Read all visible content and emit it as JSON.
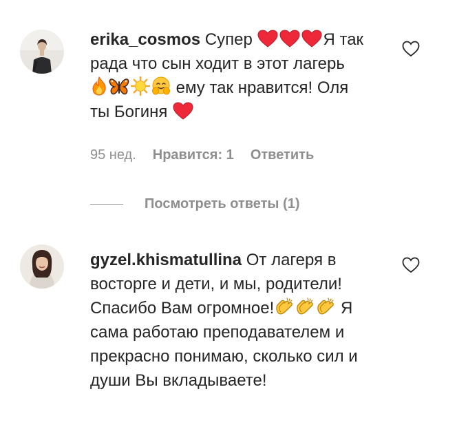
{
  "comments": [
    {
      "username": "erika_cosmos",
      "text_parts": [
        " Супер ",
        "Я так рада что сын ходит в этот лагерь ",
        " ему так нравится! Оля ты Богиня "
      ],
      "emojis": [
        "red-heart",
        "red-heart",
        "red-heart",
        "fire",
        "butterfly",
        "sun",
        "smiling-face-with-hands",
        "red-heart"
      ],
      "time": "95 нед.",
      "likes": "Нравится: 1",
      "reply": "Ответить",
      "view_replies": "Посмотреть ответы (1)"
    },
    {
      "username": "gyzel.khismatullina",
      "text_parts": [
        " От лагеря в восторге и дети, и мы, родители! Спасибо Вам огромное!",
        " Я сама работаю преподавателем и прекрасно понимаю, сколько сил и души Вы вкладываете!"
      ],
      "emojis": [
        "clapping-hands",
        "clapping-hands",
        "clapping-hands"
      ]
    }
  ],
  "colors": {
    "text": "#262626",
    "secondary": "#8e8e8e",
    "heart": "#ed2939",
    "emoji_yellow": "#ffc83d"
  }
}
